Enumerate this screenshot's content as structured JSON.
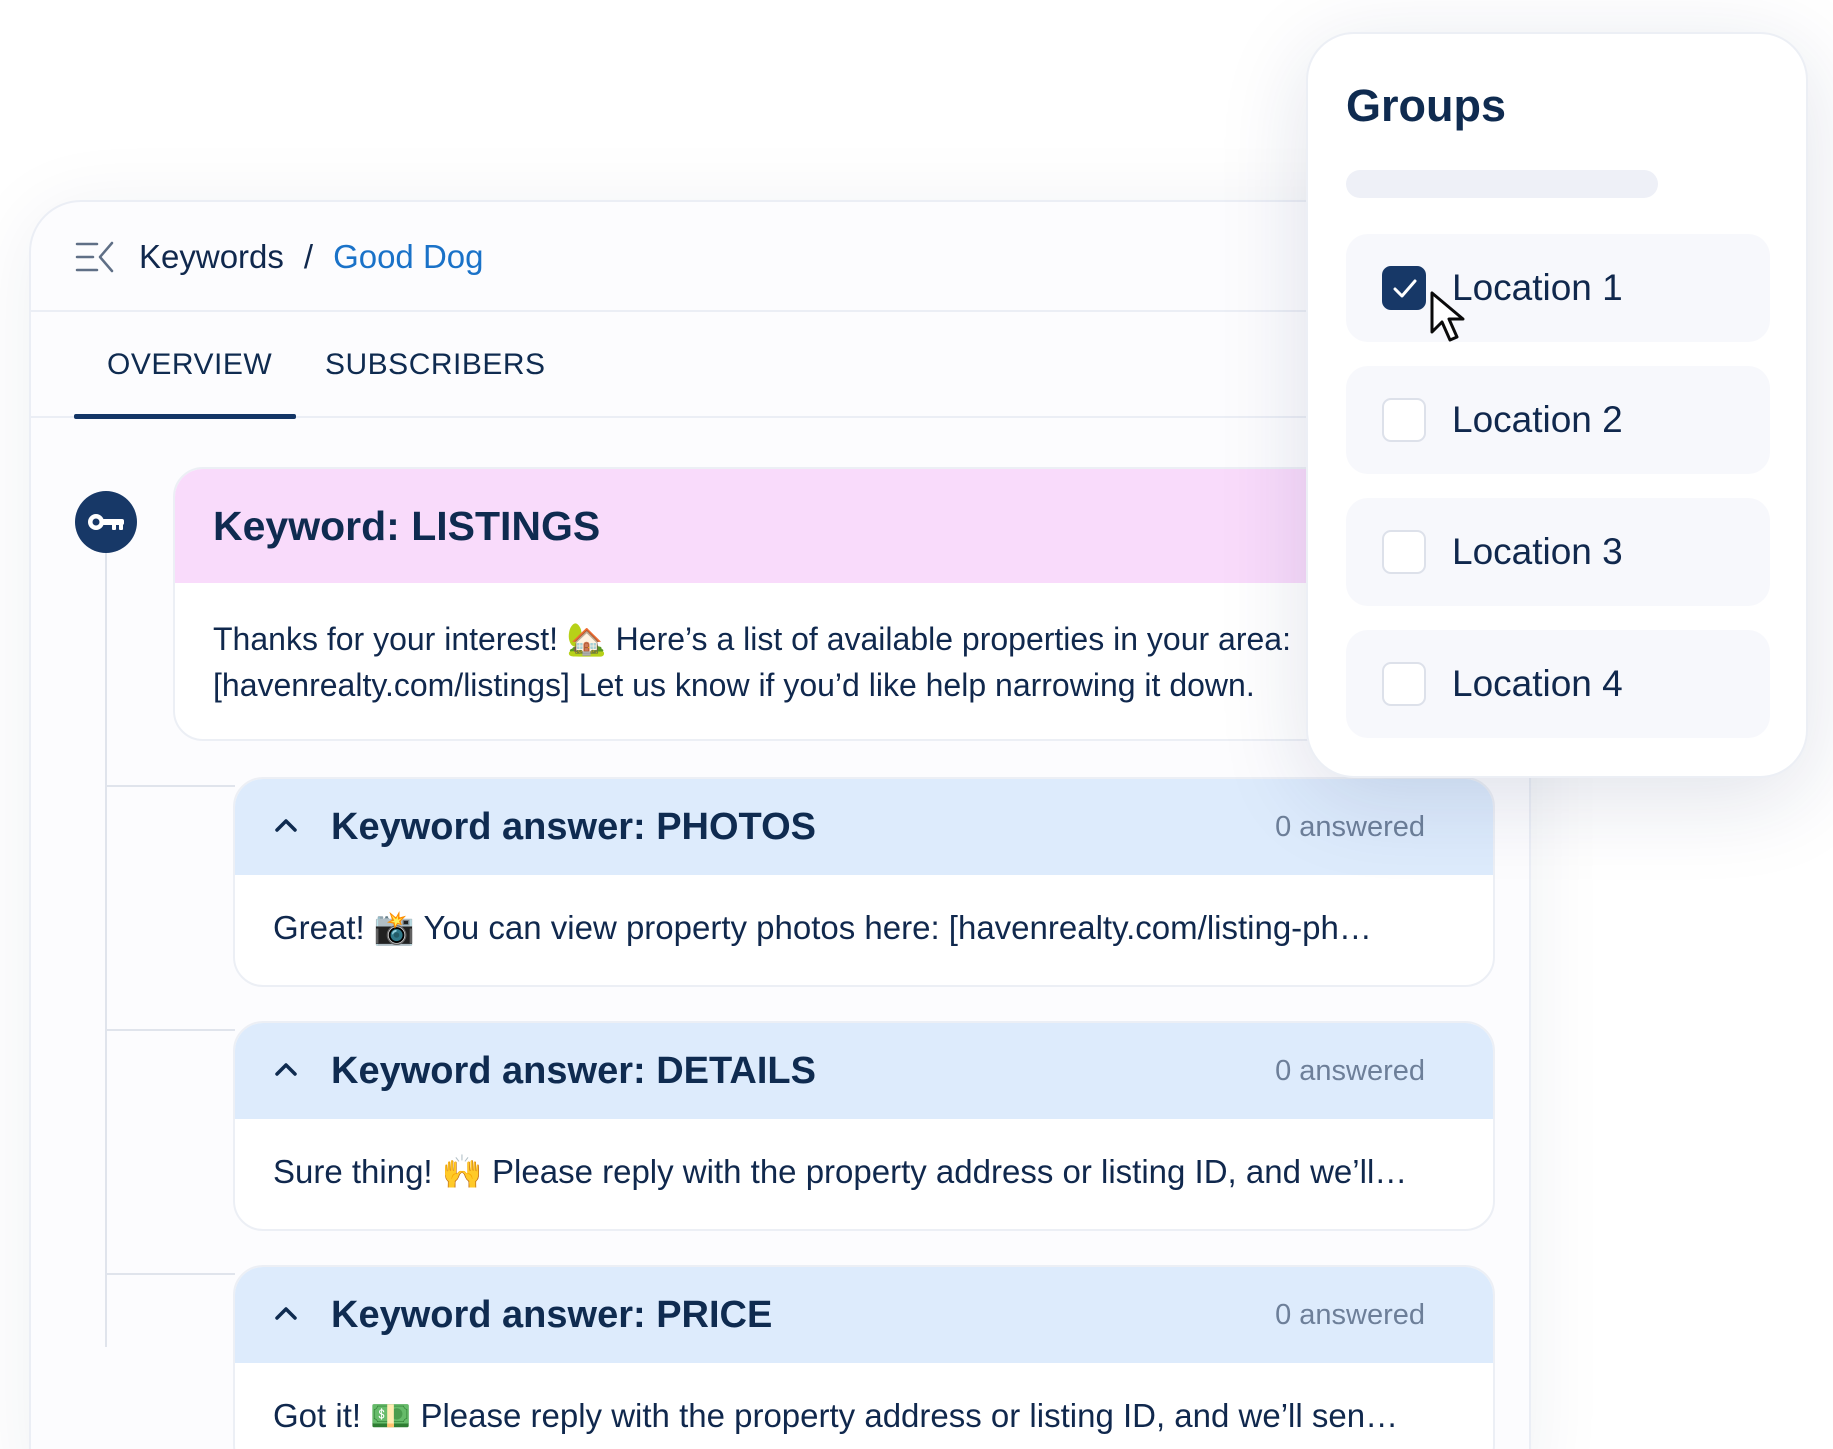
{
  "header": {
    "breadcrumb_root": "Keywords",
    "breadcrumb_separator": "/",
    "breadcrumb_current": "Good Dog"
  },
  "tabs": [
    {
      "label": "OVERVIEW",
      "active": true
    },
    {
      "label": "SUBSCRIBERS",
      "active": false
    }
  ],
  "keyword": {
    "title": "Keyword: LISTINGS",
    "message_line1": "Thanks for your interest! 🏡 Here’s a list of available properties in your area:",
    "message_line2": "[havenrealty.com/listings] Let us know if you’d like help narrowing it down."
  },
  "answers": [
    {
      "title": "Keyword answer: PHOTOS",
      "count": "0 answered",
      "message": "Great! 📸 You can view property photos here: [havenrealty.com/listing-ph…"
    },
    {
      "title": "Keyword answer: DETAILS",
      "count": "0 answered",
      "message": "Sure thing! 🙌 Please reply with the property address or listing ID, and we’ll…"
    },
    {
      "title": "Keyword answer: PRICE",
      "count": "0 answered",
      "message": "Got it! 💵 Please reply with the property address or listing ID, and we’ll sen…"
    }
  ],
  "groups": {
    "title": "Groups",
    "items": [
      {
        "label": "Location 1",
        "checked": true
      },
      {
        "label": "Location 2",
        "checked": false
      },
      {
        "label": "Location 3",
        "checked": false
      },
      {
        "label": "Location 4",
        "checked": false
      }
    ]
  },
  "colors": {
    "navy": "#173867",
    "link_blue": "#1a72c8",
    "keyword_header_bg": "#f9dbfb",
    "answer_header_bg": "#ddebfc"
  },
  "icons": {
    "menu": "menu-collapse-icon",
    "keyword_node": "key-icon",
    "answer_toggle": "chevron-up-icon",
    "check": "check-icon",
    "cursor": "mouse-pointer-icon"
  }
}
